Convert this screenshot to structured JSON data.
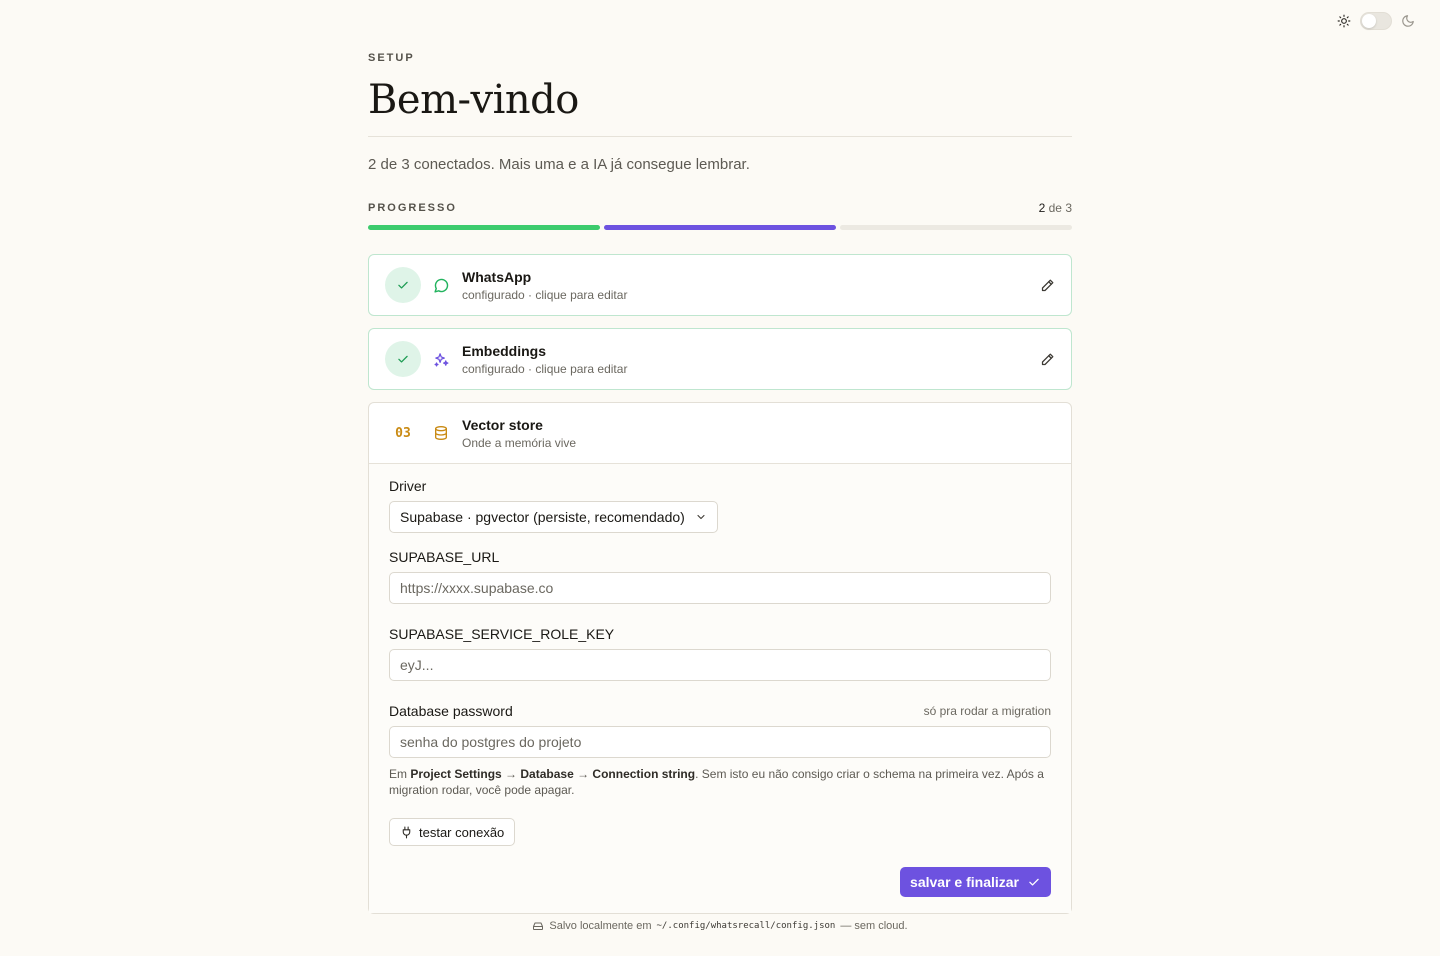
{
  "header": {
    "eyebrow": "SETUP",
    "title": "Bem-vindo",
    "subtitle": "2 de 3 conectados. Mais uma e a IA já consegue lembrar."
  },
  "progress": {
    "label": "PROGRESSO",
    "current": "2",
    "suffix": " de 3",
    "done": 2,
    "total": 3,
    "segments": [
      {
        "color": "#3ccb6d"
      },
      {
        "color": "#6d52e0"
      },
      {
        "color": "#ece9e2"
      }
    ]
  },
  "steps": [
    {
      "title": "WhatsApp",
      "subtitle": "configurado · clique para editar",
      "icon": "chat-bubble-icon",
      "status": "done"
    },
    {
      "title": "Embeddings",
      "subtitle": "configurado · clique para editar",
      "icon": "sparkles-icon",
      "status": "done"
    },
    {
      "number": "03",
      "title": "Vector store",
      "subtitle": "Onde a memória vive",
      "icon": "database-icon",
      "status": "active"
    }
  ],
  "form": {
    "driver_label": "Driver",
    "driver_value": "Supabase · pgvector (persiste, recomendado)",
    "url_label": "SUPABASE_URL",
    "url_placeholder": "https://xxxx.supabase.co",
    "key_label": "SUPABASE_SERVICE_ROLE_KEY",
    "key_placeholder": "eyJ...",
    "password_label": "Database password",
    "password_hint": "só pra rodar a migration",
    "password_placeholder": "senha do postgres do projeto",
    "help_prefix": "Em ",
    "help_b1": "Project Settings",
    "help_arrow1": " → ",
    "help_b2": "Database",
    "help_arrow2": " → ",
    "help_b3": "Connection string",
    "help_rest": ". Sem isto eu não consigo criar o schema na primeira vez. Após a migration rodar, você pode apagar.",
    "test_button": "testar conexão",
    "submit_button": "salvar e finalizar"
  },
  "footer": {
    "prefix": "Salvo localmente em",
    "path": "~/.config/whatsrecall/config.json",
    "suffix": "— sem cloud."
  },
  "colors": {
    "accent": "#6d52e0",
    "success": "#3ccb6d",
    "step_number": "#c98a13",
    "background": "#fcfaf5"
  }
}
